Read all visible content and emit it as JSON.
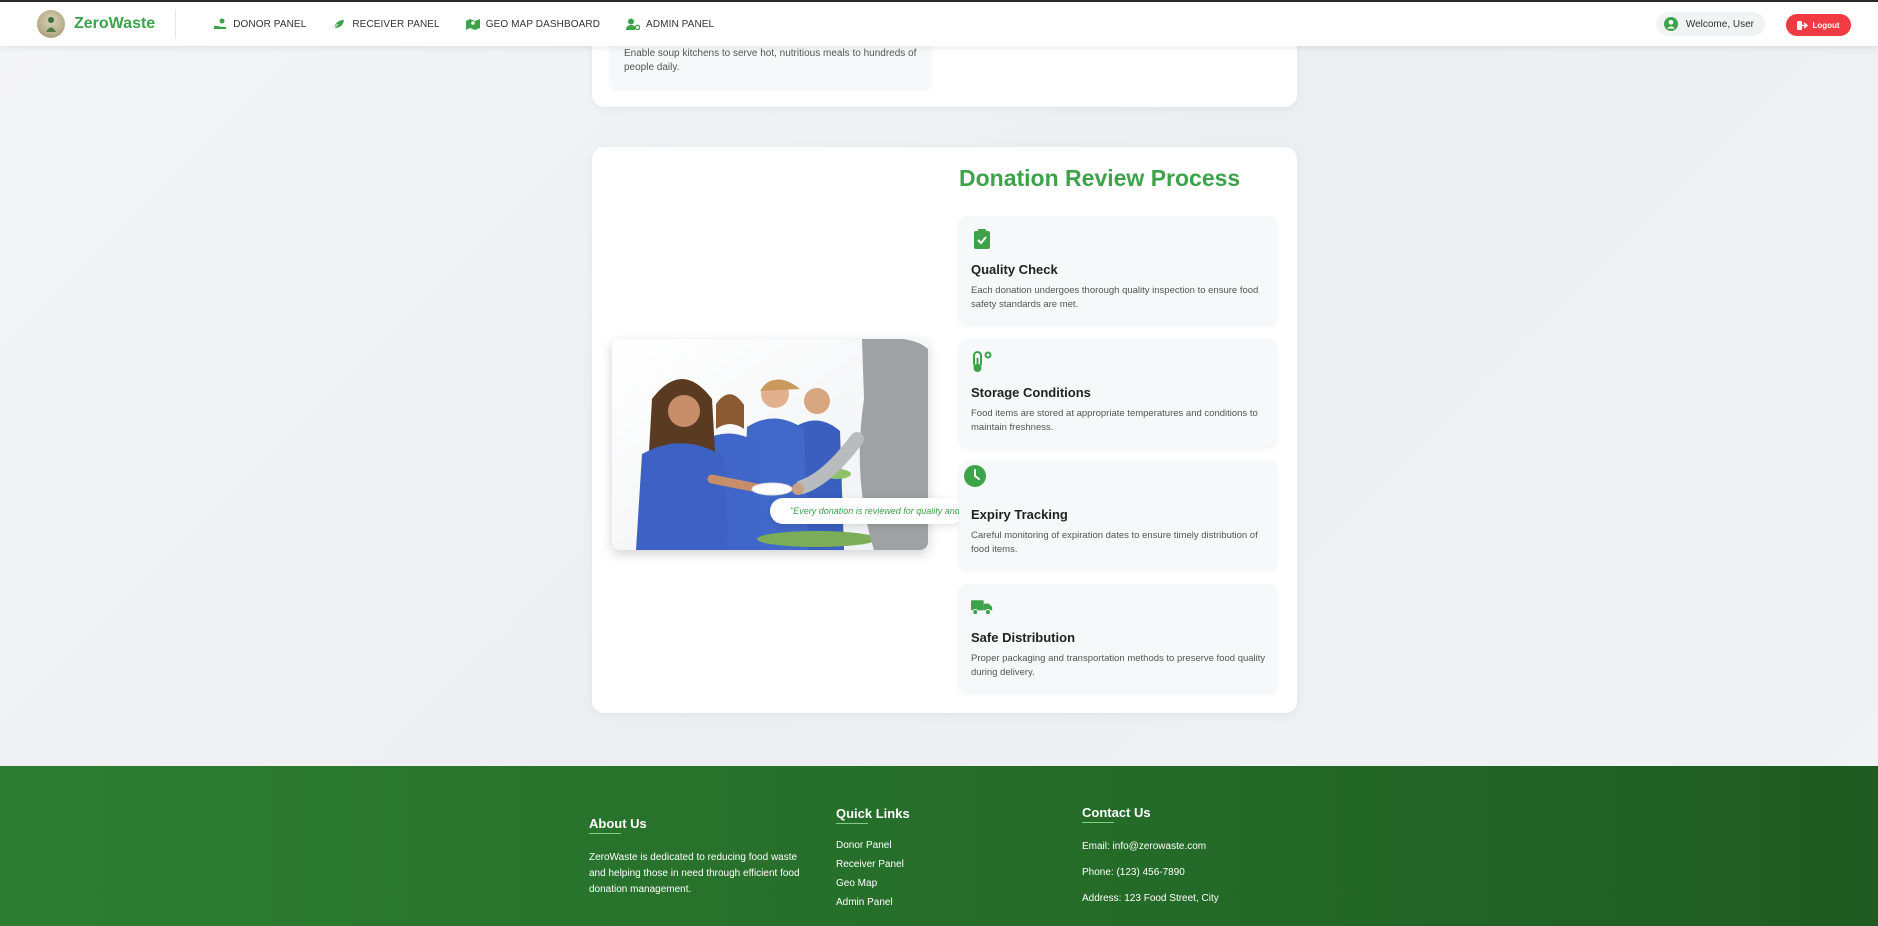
{
  "navbar": {
    "brand_name": "ZeroWaste",
    "links": [
      {
        "label": "DONOR PANEL"
      },
      {
        "label": "RECEIVER PANEL"
      },
      {
        "label": "GEO MAP DASHBOARD"
      },
      {
        "label": "ADMIN PANEL"
      }
    ],
    "welcome_text": "Welcome, User",
    "logout_label": "Logout"
  },
  "top_card": {
    "description": "Enable soup kitchens to serve hot, nutritious meals to hundreds of people daily."
  },
  "review": {
    "title": "Donation Review Process",
    "quote": "\"Every donation is reviewed for quality and safety\"",
    "steps": [
      {
        "icon": "clipboard-check-icon",
        "title": "Quality Check",
        "description": "Each donation undergoes thorough quality inspection to ensure food safety standards are met."
      },
      {
        "icon": "temperature-icon",
        "title": "Storage Conditions",
        "description": "Food items are stored at appropriate temperatures and conditions to maintain freshness."
      },
      {
        "icon": "clock-icon",
        "title": "Expiry Tracking",
        "description": "Careful monitoring of expiration dates to ensure timely distribution of food items."
      },
      {
        "icon": "truck-icon",
        "title": "Safe Distribution",
        "description": "Proper packaging and transportation methods to preserve food quality during delivery."
      }
    ]
  },
  "footer": {
    "about": {
      "heading": "About Us",
      "text": "ZeroWaste is dedicated to reducing food waste and helping those in need through efficient food donation management."
    },
    "quick_links": {
      "heading": "Quick Links",
      "items": [
        "Donor Panel",
        "Receiver Panel",
        "Geo Map",
        "Admin Panel"
      ]
    },
    "contact": {
      "heading": "Contact Us",
      "email": "Email: info@zerowaste.com",
      "phone": "Phone: (123) 456-7890",
      "address": "Address: 123 Food Street, City"
    }
  },
  "colors": {
    "brand_green": "#3da34a",
    "logout_red": "#ef3b41",
    "footer_green": "#2e7d32"
  }
}
